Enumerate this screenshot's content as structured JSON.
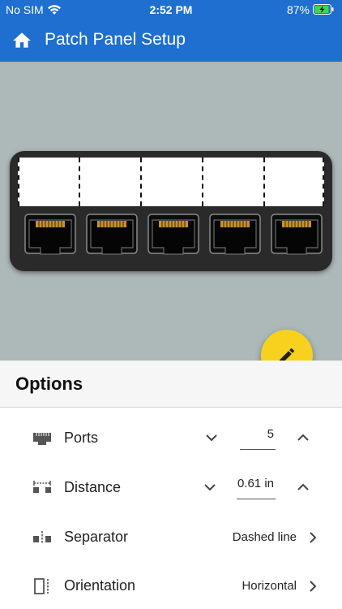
{
  "status_bar": {
    "carrier": "No SIM",
    "time": "2:52 PM",
    "battery": "87%"
  },
  "app_bar": {
    "title": "Patch Panel Setup",
    "home_icon": "home-icon",
    "color": "#1e6fcf"
  },
  "preview": {
    "background": "#adb8b8",
    "port_count": 5,
    "separator_style": "dashed"
  },
  "fab": {
    "icon": "pencil-icon",
    "color": "#f7d11e"
  },
  "options": {
    "header": "Options",
    "ports": {
      "label": "Ports",
      "value": "5",
      "icon": "patch-port-icon"
    },
    "distance": {
      "label": "Distance",
      "value": "0.61 in",
      "icon": "distance-icon"
    },
    "separator": {
      "label": "Separator",
      "value": "Dashed line",
      "icon": "separator-icon"
    },
    "orientation": {
      "label": "Orientation",
      "value": "Horizontal",
      "icon": "orientation-icon"
    }
  }
}
